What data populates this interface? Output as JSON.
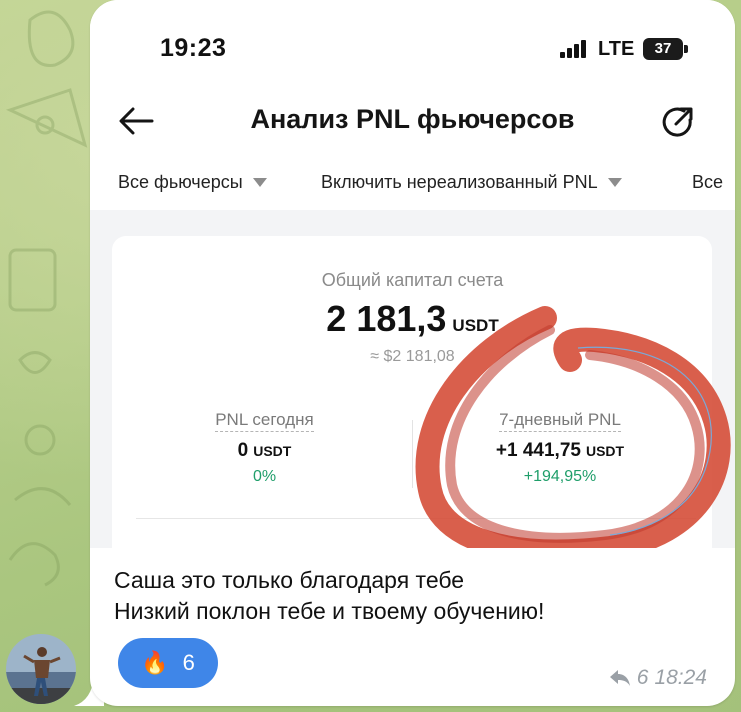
{
  "status_bar": {
    "time": "19:23",
    "network": "LTE",
    "battery": "37"
  },
  "app_header": {
    "title": "Анализ PNL фьючерсов",
    "back_icon": "arrow-left-icon",
    "share_icon": "share-icon"
  },
  "filters": [
    {
      "label": "Все фьючерсы"
    },
    {
      "label": "Включить нереализованный PNL"
    },
    {
      "label": "Все"
    }
  ],
  "capital": {
    "label": "Общий капитал счета",
    "value": "2 181,3",
    "unit": "USDT",
    "usd": "≈ $2 181,08"
  },
  "stats": {
    "today": {
      "label": "PNL сегодня",
      "value": "0",
      "unit": "USDT",
      "pct": "0%"
    },
    "week": {
      "label": "7-дневный PNL",
      "value": "+1 441,75",
      "unit": "USDT",
      "pct": "+194,95%"
    }
  },
  "message": {
    "line1": "Саша это только благодаря тебе",
    "line2": "Низкий поклон тебе и твоему обучению!",
    "reaction": {
      "emoji": "🔥",
      "count": "6"
    },
    "forwards": "6",
    "time": "18:24"
  },
  "colors": {
    "accent": "#3f86e8",
    "positive": "#1f9e6a",
    "annotation": "#d2432d"
  }
}
